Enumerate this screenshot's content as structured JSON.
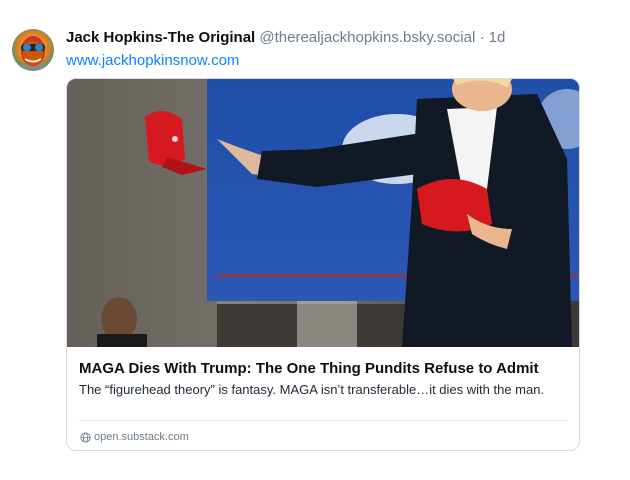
{
  "post": {
    "author": {
      "display_name": "Jack Hopkins-The Original",
      "handle": "@therealjackhopkins.bsky.social",
      "separator": "·",
      "time_ago": "1d"
    },
    "link_text": "www.jackhopkinsnow.com",
    "embed": {
      "title": "MAGA Dies With Trump: The One Thing Pundits Refuse to Admit",
      "description": "The “figurehead theory” is fantasy. MAGA isn’t transferable…it dies with the man.",
      "domain": "open.substack.com",
      "domain_icon": "globe-icon"
    }
  },
  "colors": {
    "link": "#1083fe",
    "muted": "#6f7c8d",
    "border": "#d4dbe2"
  }
}
